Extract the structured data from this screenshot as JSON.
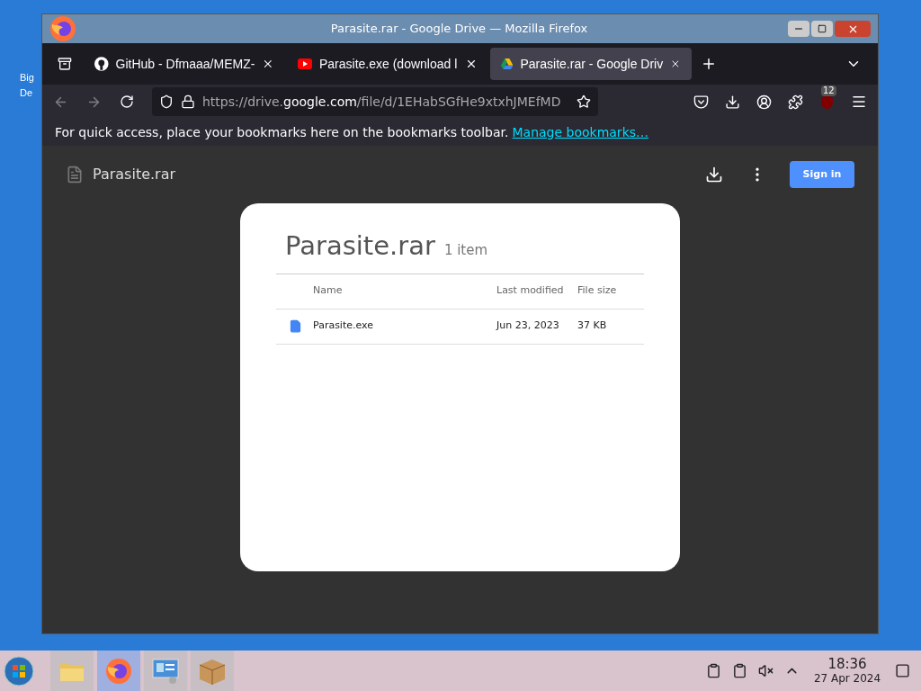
{
  "desktop": {
    "icons": [
      {
        "label": "Big",
        "label_2": "De"
      }
    ]
  },
  "window": {
    "title": "Parasite.rar - Google Drive — Mozilla Firefox"
  },
  "tabs": [
    {
      "label": "GitHub - Dfmaaa/MEMZ-",
      "kind": "github",
      "selected": false
    },
    {
      "label": "Parasite.exe (download l",
      "kind": "youtube",
      "selected": false
    },
    {
      "label": "Parasite.rar - Google Driv",
      "kind": "drive",
      "selected": true
    }
  ],
  "url": {
    "prefix": "https://drive.",
    "domain": "google.com",
    "path": "/file/d/1EHabSGfHe9xtxhJMEfMD"
  },
  "extension_badge": "12",
  "bookmarks_bar": {
    "message": "For quick access, place your bookmarks here on the bookmarks toolbar.",
    "link": "Manage bookmarks…"
  },
  "drive_header": {
    "file_name": "Parasite.rar",
    "sign_in": "Sign in"
  },
  "archive": {
    "title": "Parasite.rar",
    "count": "1 item",
    "columns": [
      "Name",
      "Last modified",
      "File size"
    ],
    "rows": [
      {
        "name": "Parasite.exe",
        "modified": "Jun 23, 2023",
        "size": "37 KB"
      }
    ]
  },
  "taskbar": {
    "apps": [
      {
        "kind": "folder",
        "selected": false
      },
      {
        "kind": "firefox",
        "selected": true
      },
      {
        "kind": "monitor",
        "selected": false
      },
      {
        "kind": "package",
        "selected": false
      }
    ],
    "time": "18:36",
    "date": "27 Apr 2024"
  }
}
